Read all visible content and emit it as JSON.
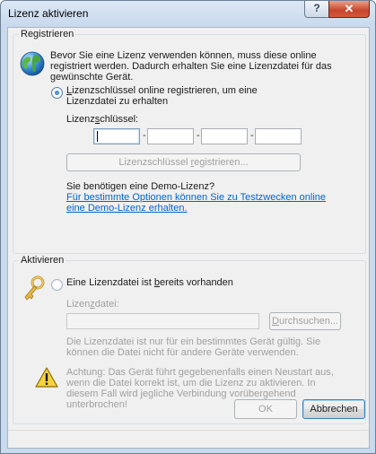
{
  "window": {
    "title": "Lizenz aktivieren",
    "help_glyph": "?",
    "close_glyph": "✕"
  },
  "register_group": {
    "label": "Registrieren",
    "intro": "Bevor Sie eine Lizenz verwenden können, muss diese online registriert werden. Dadurch erhalten Sie eine Lizenzdatei für das gewünschte Gerät.",
    "radio_label_pre": "",
    "radio_label_u": "L",
    "radio_label_post": "izenzschlüssel online registrieren, um eine Lizenzdatei zu erhalten",
    "radio_selected": true,
    "key_label_pre": "Lizenz",
    "key_label_u": "s",
    "key_label_post": "chlüssel:",
    "key_values": [
      "",
      "",
      "",
      ""
    ],
    "register_button_pre": "Lizenzschlüssel ",
    "register_button_u": "r",
    "register_button_post": "egistrieren...",
    "demo_question": "Sie benötigen eine Demo-Lizenz?",
    "demo_link": "Für bestimmte Optionen können Sie zu Testzwecken online eine Demo-Lizenz erhalten."
  },
  "activate_group": {
    "label": "Aktivieren",
    "radio_label_pre": "Eine Lizenzdatei ist ",
    "radio_label_u": "b",
    "radio_label_post": "ereits vorhanden",
    "radio_selected": false,
    "file_label_pre": "Lizen",
    "file_label_u": "z",
    "file_label_post": "datei:",
    "file_value": "",
    "browse_pre": "",
    "browse_u": "D",
    "browse_post": "urchsuchen...",
    "info": "Die Lizenzdatei ist nur für ein bestimmtes Gerät gültig. Sie können die Datei nicht für andere Geräte verwenden.",
    "warning": "Achtung: Das Gerät führt gegebenenfalls einen Neustart aus, wenn die Datei korrekt ist, um die Lizenz zu aktivieren. In diesem Fall wird jegliche Verbindung vorübergehend unterbrochen!"
  },
  "footer": {
    "ok_label": "OK",
    "cancel_label": "Abbrechen"
  },
  "icons": {
    "register": "globe-icon",
    "activate": "key-icon",
    "warning": "warning-icon"
  }
}
